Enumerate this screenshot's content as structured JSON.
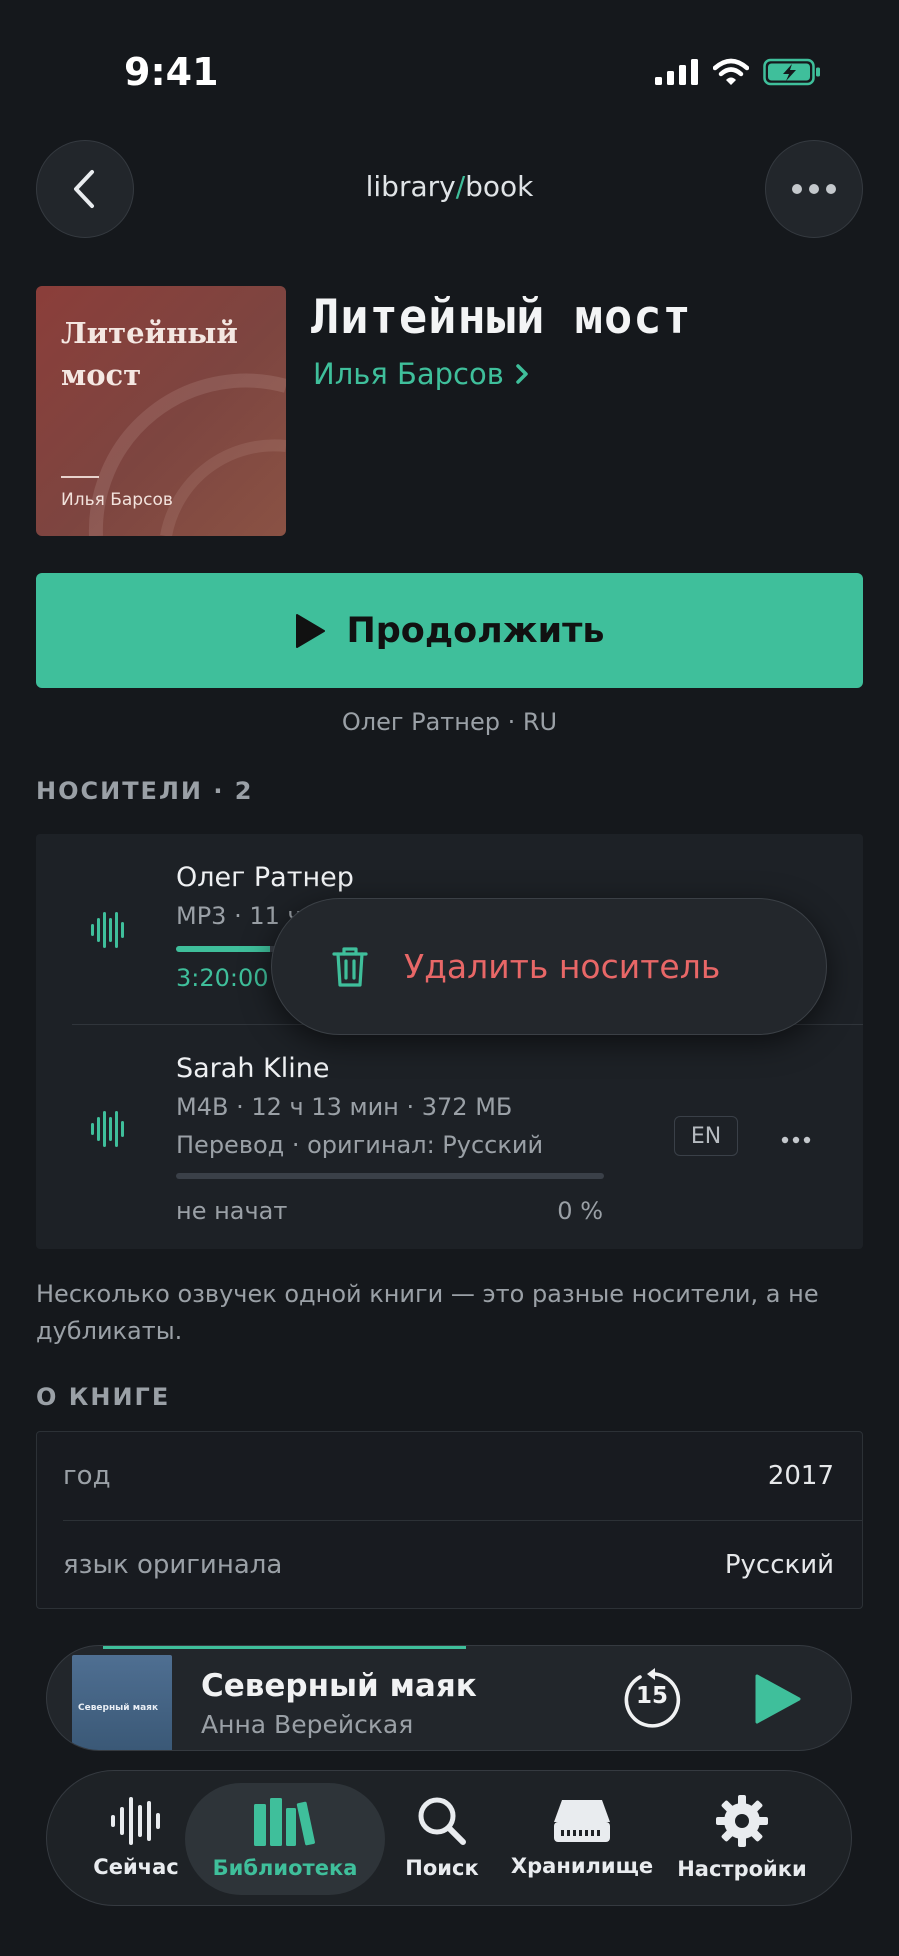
{
  "status_bar": {
    "time": "9:41"
  },
  "header": {
    "breadcrumb_parent": "library",
    "breadcrumb_sep": "/",
    "breadcrumb_current": "book"
  },
  "book": {
    "cover_title": "Литейный мост",
    "cover_author": "Илья Барсов",
    "title": "Литейный мост",
    "author": "Илья Барсов"
  },
  "continue": {
    "label": "Продолжить",
    "subtitle": "Олег Ратнер · RU"
  },
  "media": {
    "section_title": "НОСИТЕЛИ · 2",
    "items": [
      {
        "narrator": "Олег Ратнер",
        "meta": "MP3 · 11 ч",
        "time": "3:20:00",
        "progress": 0.22
      },
      {
        "narrator": "Sarah Kline",
        "meta": "M4B · 12 ч 13 мин · 372 МБ",
        "note": "Перевод · оригинал: Русский",
        "language": "EN",
        "status": "не начат",
        "percent": "0 %",
        "progress": 0
      }
    ]
  },
  "context_menu": {
    "delete_label": "Удалить носитель"
  },
  "hint": "Несколько озвучек одной книги — это разные носители, а не дубликаты.",
  "about": {
    "section_title": "О КНИГЕ",
    "rows": [
      {
        "key": "год",
        "value": "2017"
      },
      {
        "key": "язык оригинала",
        "value": "Русский"
      }
    ]
  },
  "mini_player": {
    "title": "Северный маяк",
    "artist": "Анна Верейская",
    "cover_text": "Северный маяк",
    "rewind_seconds": "15",
    "progress": 0.45
  },
  "tabs": [
    {
      "label": "Сейчас",
      "icon": "waveform-icon"
    },
    {
      "label": "Библиотека",
      "icon": "books-icon",
      "active": true
    },
    {
      "label": "Поиск",
      "icon": "search-icon"
    },
    {
      "label": "Хранилище",
      "icon": "storage-icon"
    },
    {
      "label": "Настройки",
      "icon": "gear-icon"
    }
  ],
  "colors": {
    "accent": "#3fbf9b",
    "danger": "#e86767",
    "background": "#15181c"
  }
}
